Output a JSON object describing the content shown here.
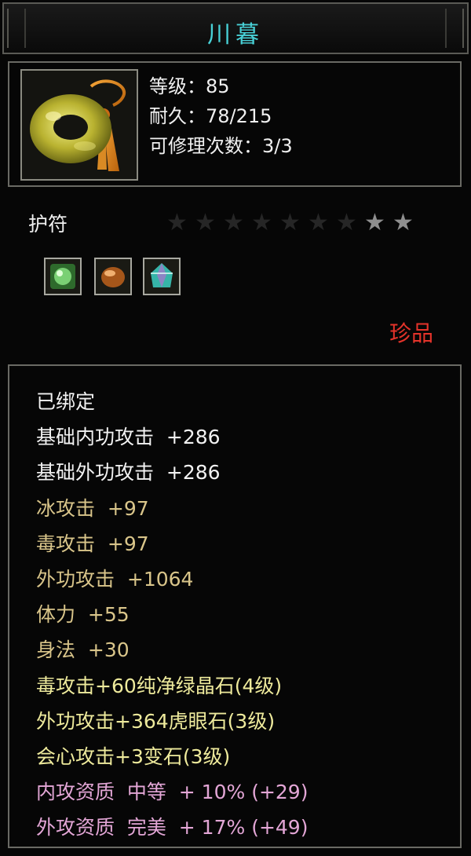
{
  "window": {
    "title": "川暮"
  },
  "item": {
    "icon": "jade-amulet-icon",
    "level_line": "等级：85",
    "durability_line": "耐久：78/215",
    "repair_line": "可修理次数：3/3",
    "type": "护符",
    "stars_total": 9,
    "stars_filled": 2,
    "sockets": [
      {
        "icon": "green-gem-icon",
        "color": "#3c8a3a"
      },
      {
        "icon": "amber-stone-icon",
        "color": "#b5651d"
      },
      {
        "icon": "prism-crystal-icon",
        "color": "#40c0b0"
      }
    ],
    "rarity": "珍品"
  },
  "attributes": [
    {
      "text": "已绑定",
      "color": "white"
    },
    {
      "text": "基础内功攻击  +286",
      "color": "white"
    },
    {
      "text": "基础外功攻击  +286",
      "color": "white"
    },
    {
      "text": "冰攻击  +97",
      "color": "gold"
    },
    {
      "text": "毒攻击  +97",
      "color": "gold"
    },
    {
      "text": "外功攻击  +1064",
      "color": "gold"
    },
    {
      "text": "体力  +55",
      "color": "gold"
    },
    {
      "text": "身法  +30",
      "color": "gold"
    },
    {
      "text": "毒攻击+60纯净绿晶石(4级)",
      "color": "yellow"
    },
    {
      "text": "外功攻击+364虎眼石(3级)",
      "color": "yellow"
    },
    {
      "text": "会心攻击+3变石(3级)",
      "color": "yellow"
    },
    {
      "text": "内攻资质  中等  + 10% (+29)",
      "color": "pink"
    },
    {
      "text": "外攻资质  完美  + 17% (+49)",
      "color": "pink"
    }
  ],
  "colors": {
    "title": "#48d0d6",
    "rarity": "#e4332a",
    "star_filled": "#8e8e8e",
    "star_empty": "#262626"
  }
}
